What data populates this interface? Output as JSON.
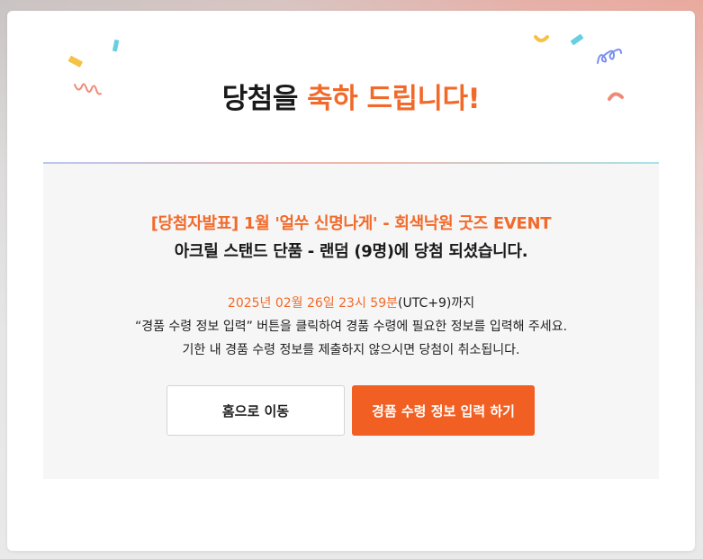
{
  "heading": {
    "prefix": "당첨을 ",
    "accent": "축하 드립니다!"
  },
  "event": {
    "title": "[당첨자발표] 1월 '얼쑤 신명나게' - 회색낙원 굿즈 EVENT",
    "prize": "아크릴 스탠드 단품 - 랜덤 (9명)에 당첨 되셨습니다."
  },
  "instructions": {
    "deadline": "2025년 02월 26일 23시 59분",
    "timezone": "(UTC+9)까지",
    "line2": "“경품 수령 정보 입력” 버튼을 클릭하여 경품 수령에 필요한 정보를 입력해 주세요.",
    "line3": "기한 내 경품 수령 정보를 제출하지 않으시면 당첨이 취소됩니다."
  },
  "buttons": {
    "home_label": "홈으로 이동",
    "submit_label": "경품 수령 정보 입력 하기"
  },
  "colors": {
    "accent": "#f26a2a",
    "submit_bg": "#f25f22"
  }
}
